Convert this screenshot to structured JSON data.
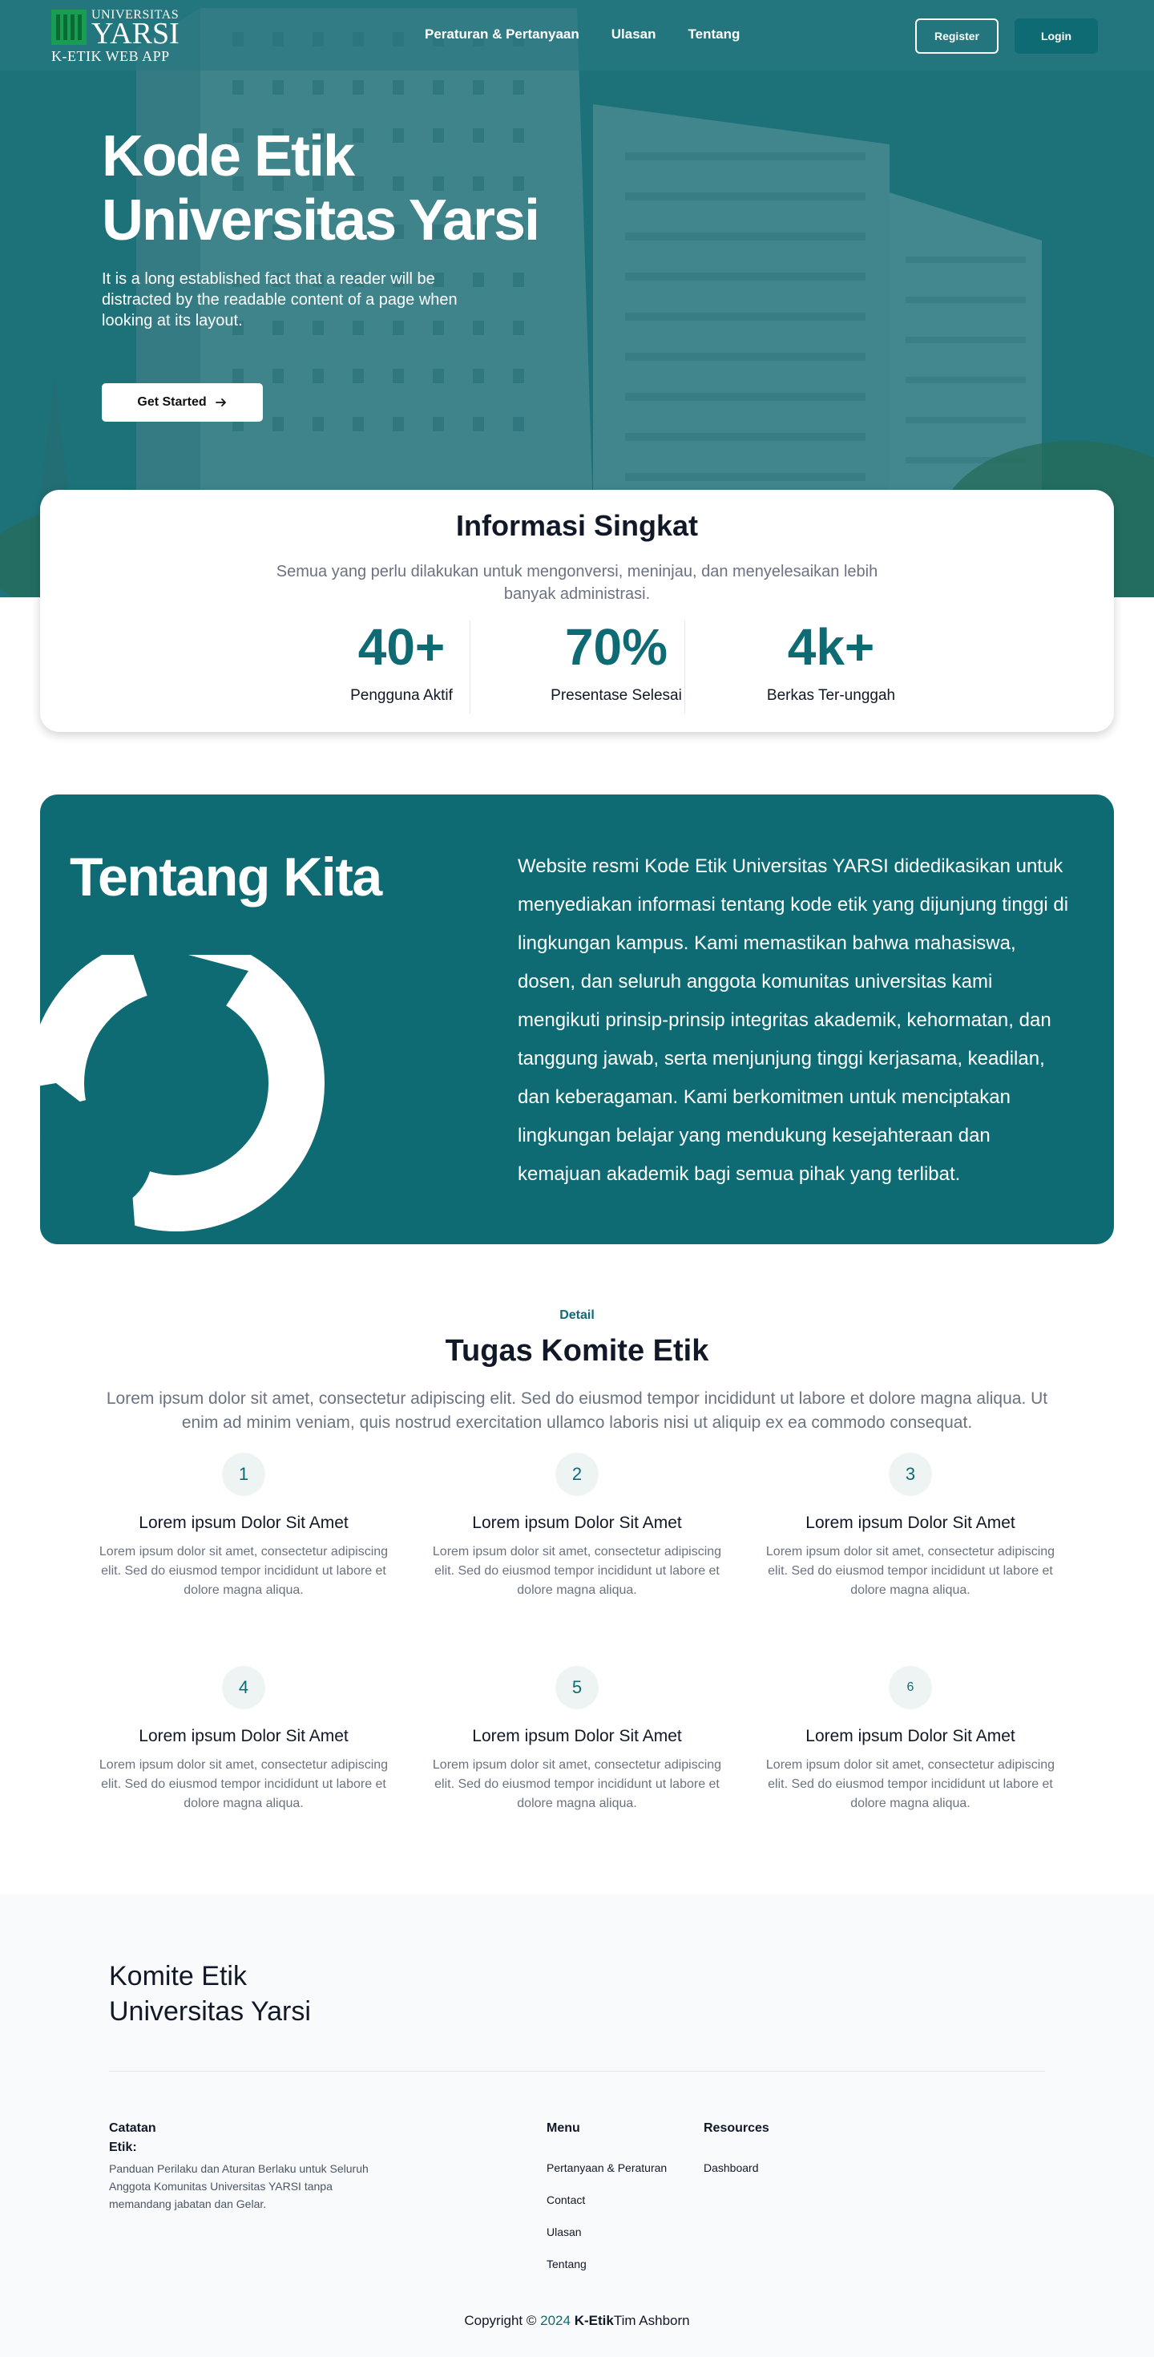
{
  "colors": {
    "primary": "#0f6b73",
    "hero_overlay": "#1b6f78",
    "footer_bg": "#f9fafb"
  },
  "logo": {
    "top": "UNIVERSITAS",
    "big": "YARSI",
    "sub": "K-ETIK WEB APP"
  },
  "nav": {
    "links": [
      "Peraturan & Pertanyaan",
      "Ulasan",
      "Tentang"
    ],
    "register": "Register",
    "login": "Login"
  },
  "hero": {
    "title": "Kode Etik Universitas Yarsi",
    "text": "It is a long established fact that a reader will be distracted by the readable content of a page when looking at its layout.",
    "cta": "Get Started",
    "cta_icon": "arrow-right-icon"
  },
  "info": {
    "title": "Informasi Singkat",
    "subtitle": "Semua yang perlu dilakukan untuk mengonversi, meninjau, dan menyelesaikan lebih banyak administrasi.",
    "stats": [
      {
        "value": "40+",
        "label": "Pengguna Aktif"
      },
      {
        "value": "70%",
        "label": "Presentase Selesai"
      },
      {
        "value": "4k+",
        "label": "Berkas Ter-unggah"
      }
    ]
  },
  "about": {
    "title": "Tentang Kita",
    "text": "Website resmi Kode Etik Universitas YARSI didedikasikan untuk menyediakan informasi tentang kode etik yang dijunjung tinggi di lingkungan kampus. Kami memastikan bahwa mahasiswa, dosen, dan seluruh anggota komunitas universitas kami mengikuti prinsip-prinsip integritas akademik, kehormatan, dan tanggung jawab, serta menjunjung tinggi kerjasama, keadilan, dan keberagaman. Kami berkomitmen untuk menciptakan lingkungan belajar yang mendukung kesejahteraan dan kemajuan akademik bagi semua pihak yang terlibat."
  },
  "detail": {
    "label": "Detail",
    "title": "Tugas Komite Etik",
    "subtitle": "Lorem ipsum dolor sit amet, consectetur adipiscing elit. Sed do eiusmod tempor incididunt ut labore et dolore magna aliqua. Ut enim ad minim veniam, quis nostrud exercitation ullamco laboris nisi ut aliquip ex ea commodo consequat.",
    "tasks": [
      {
        "num": "1",
        "title": "Lorem ipsum Dolor Sit Amet",
        "desc": "Lorem ipsum dolor sit amet, consectetur adipiscing elit. Sed do eiusmod tempor incididunt ut labore et dolore magna aliqua."
      },
      {
        "num": "2",
        "title": "Lorem ipsum Dolor Sit Amet",
        "desc": "Lorem ipsum dolor sit amet, consectetur adipiscing elit. Sed do eiusmod tempor incididunt ut labore et dolore magna aliqua."
      },
      {
        "num": "3",
        "title": "Lorem ipsum Dolor Sit Amet",
        "desc": "Lorem ipsum dolor sit amet, consectetur adipiscing elit. Sed do eiusmod tempor incididunt ut labore et dolore magna aliqua."
      },
      {
        "num": "4",
        "title": "Lorem ipsum Dolor Sit Amet",
        "desc": "Lorem ipsum dolor sit amet, consectetur adipiscing elit. Sed do eiusmod tempor incididunt ut labore et dolore magna aliqua."
      },
      {
        "num": "5",
        "title": "Lorem ipsum Dolor Sit Amet",
        "desc": "Lorem ipsum dolor sit amet, consectetur adipiscing elit. Sed do eiusmod tempor incididunt ut labore et dolore magna aliqua."
      },
      {
        "num": "6",
        "title": "Lorem ipsum Dolor Sit Amet",
        "desc": "Lorem ipsum dolor sit amet, consectetur adipiscing elit. Sed do eiusmod tempor incididunt ut labore et dolore magna aliqua."
      }
    ]
  },
  "footer": {
    "brand": "Komite Etik Universitas Yarsi",
    "catatan_title": "Catatan Etik:",
    "catatan_text": "Panduan Perilaku dan Aturan Berlaku untuk Seluruh Anggota Komunitas Universitas YARSI tanpa memandang jabatan dan Gelar.",
    "menu_title": "Menu",
    "menu_links": [
      "Pertanyaan & Peraturan",
      "Contact",
      "Ulasan",
      "Tentang"
    ],
    "resources_title": "Resources",
    "resources_links": [
      "Dashboard"
    ],
    "copyright_prefix": "Copyright ©",
    "copyright_year": "2024",
    "copyright_brand": "K-Etik",
    "copyright_suffix": "Tim Ashborn"
  }
}
